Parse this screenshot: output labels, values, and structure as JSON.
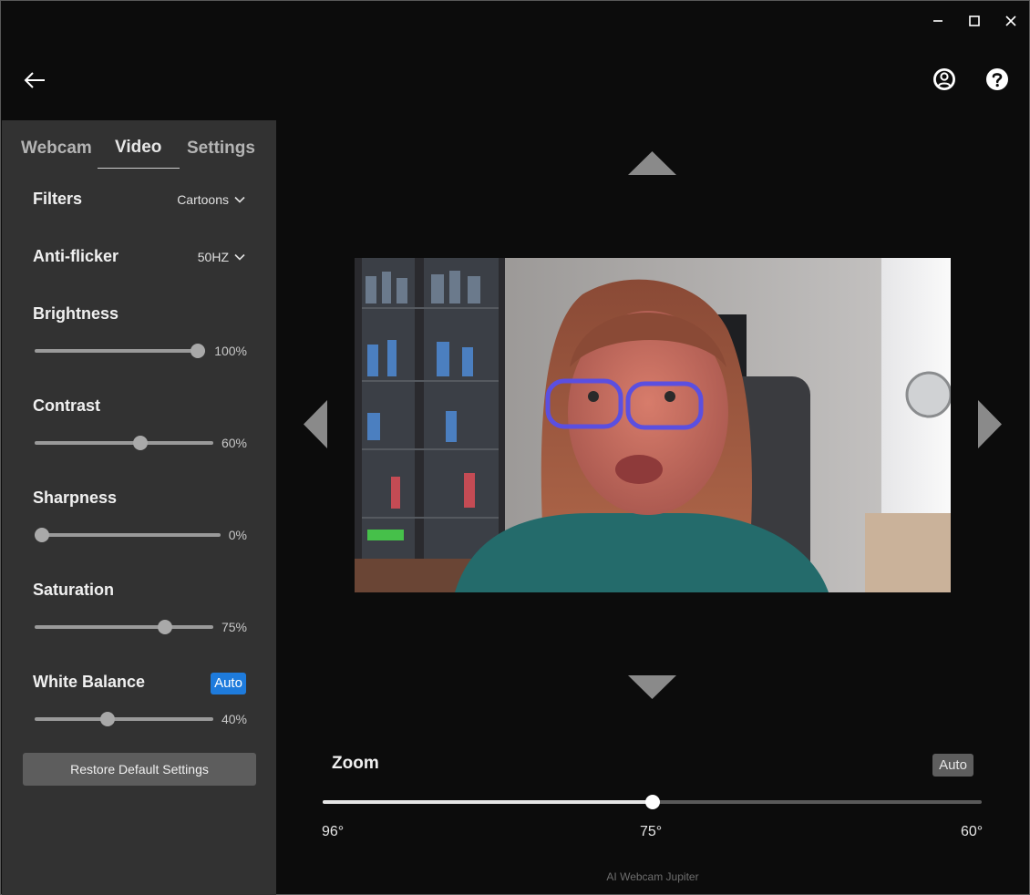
{
  "window": {
    "minimize_icon": "minimize-icon",
    "maximize_icon": "maximize-icon",
    "close_icon": "close-icon"
  },
  "header": {
    "back_icon": "arrow-left-icon",
    "account_icon": "account-icon",
    "help_icon": "question-icon"
  },
  "sidebar": {
    "tabs": [
      {
        "label": "Webcam",
        "active": false
      },
      {
        "label": "Video",
        "active": true
      },
      {
        "label": "Settings",
        "active": false
      }
    ],
    "filters": {
      "label": "Filters",
      "value": "Cartoons"
    },
    "anti_flicker": {
      "label": "Anti-flicker",
      "value": "50HZ"
    },
    "sliders": [
      {
        "label": "Brightness",
        "value": 100,
        "display": "100%"
      },
      {
        "label": "Contrast",
        "value": 60,
        "display": "60%"
      },
      {
        "label": "Sharpness",
        "value": 0,
        "display": "0%"
      },
      {
        "label": "Saturation",
        "value": 75,
        "display": "75%"
      },
      {
        "label": "White Balance",
        "value": 40,
        "display": "40%",
        "auto_label": "Auto"
      }
    ],
    "restore_label": "Restore Default Settings"
  },
  "zoom": {
    "label": "Zoom",
    "auto_label": "Auto",
    "value_fraction": 0.5,
    "ticks": [
      "96°",
      "75°",
      "60°"
    ]
  },
  "footer": {
    "text": "AI Webcam Jupiter"
  },
  "colors": {
    "accent": "#1e7bdc",
    "background": "#0c0c0c",
    "sidebar": "#323232"
  }
}
